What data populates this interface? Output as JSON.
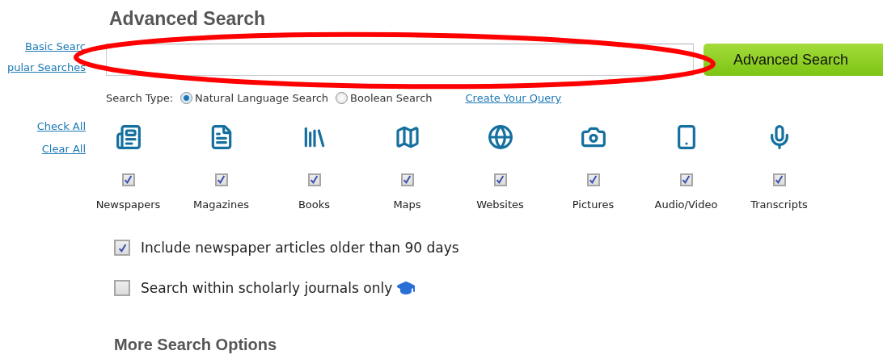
{
  "title": "Advanced Search",
  "side_links": [
    {
      "label": "Basic Searc"
    },
    {
      "label": "pular Searches"
    }
  ],
  "search_button": "Advanced Search",
  "search_type": {
    "label": "Search Type:",
    "options": [
      {
        "label": "Natural Language Search",
        "selected": true
      },
      {
        "label": "Boolean Search",
        "selected": false
      }
    ]
  },
  "create_query_link": "Create Your Query",
  "select_links": [
    "Check All",
    "Clear All"
  ],
  "categories": [
    {
      "kind": "newspaper",
      "label": "Newspapers",
      "checked": true
    },
    {
      "kind": "magazine",
      "label": "Magazines",
      "checked": true
    },
    {
      "kind": "book",
      "label": "Books",
      "checked": true
    },
    {
      "kind": "map",
      "label": "Maps",
      "checked": true
    },
    {
      "kind": "website",
      "label": "Websites",
      "checked": true
    },
    {
      "kind": "picture",
      "label": "Pictures",
      "checked": true
    },
    {
      "kind": "audio",
      "label": "Audio/Video",
      "checked": true
    },
    {
      "kind": "transcript",
      "label": "Transcripts",
      "checked": true
    }
  ],
  "options": [
    {
      "kind": "plain",
      "label": "Include newspaper articles older than 90 days",
      "checked": true
    },
    {
      "kind": "scholarly",
      "label": "Search within scholarly journals only",
      "checked": false
    }
  ],
  "more_options_heading": "More Search Options",
  "annotation": {
    "kind": "ellipse"
  }
}
